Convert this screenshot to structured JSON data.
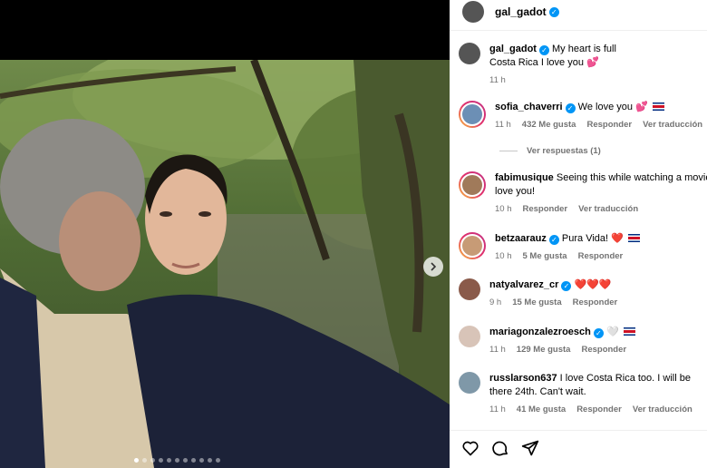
{
  "post": {
    "username": "gal_gadot"
  },
  "caption": {
    "username": "gal_gadot",
    "line1": "My heart is full",
    "line2": "Costa Rica I love you 💕",
    "time": "11 h"
  },
  "comments": [
    {
      "username": "sofia_chaverri",
      "verified": true,
      "text": "We love you 💕",
      "flags": 2,
      "time": "11 h",
      "likes": "432 Me gusta",
      "reply": "Responder",
      "translate": "Ver traducción"
    },
    {
      "username": "fabimusique",
      "verified": false,
      "text": "Seeing this while watching a movie love you!",
      "time": "10 h",
      "reply": "Responder",
      "translate": "Ver traducción"
    },
    {
      "username": "betzaarauz",
      "verified": true,
      "text": "Pura Vida! ❤️",
      "flags": 1,
      "time": "10 h",
      "likes": "5 Me gusta",
      "reply": "Responder"
    },
    {
      "username": "natyalvarez_cr",
      "verified": true,
      "text": "❤️❤️❤️",
      "time": "9 h",
      "likes": "15 Me gusta",
      "reply": "Responder"
    },
    {
      "username": "mariagonzalezroesch",
      "verified": true,
      "text": "🤍",
      "flags": 1,
      "time": "11 h",
      "likes": "129 Me gusta",
      "reply": "Responder"
    },
    {
      "username": "russlarson637",
      "verified": false,
      "text": "I love Costa Rica too. I will be there 24th. Can't wait.",
      "time": "11 h",
      "likes": "41 Me gusta",
      "reply": "Responder",
      "translate": "Ver traducción"
    }
  ],
  "replies_label": "Ver respuestas (1)",
  "actions": [
    "heart-icon",
    "comment-icon",
    "share-icon"
  ],
  "carousel": {
    "count": 11,
    "active_index": 0
  },
  "colors": {
    "verified": "#0095f6",
    "meta": "#737373",
    "flag_red": "#ce1126",
    "flag_blue": "#002b7f"
  }
}
